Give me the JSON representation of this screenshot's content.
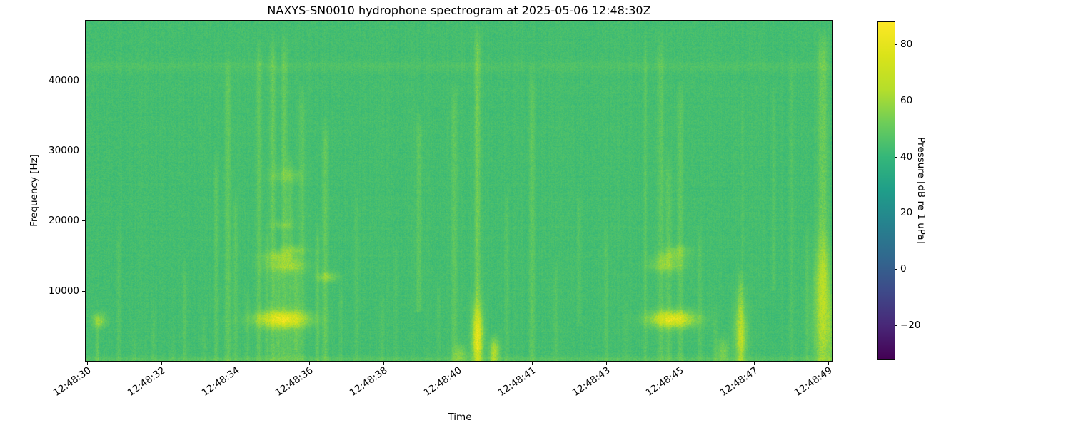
{
  "chart_data": {
    "type": "heatmap",
    "subtype": "spectrogram",
    "title": "NAXYS-SN0010 hydrophone spectrogram at 2025-05-06 12:48:30Z",
    "xlabel": "Time",
    "ylabel": "Frequency [Hz]",
    "x_ticks": [
      "12:48:30",
      "12:48:32",
      "12:48:34",
      "12:48:36",
      "12:48:38",
      "12:48:40",
      "12:48:41",
      "12:48:43",
      "12:48:45",
      "12:48:47",
      "12:48:49"
    ],
    "x_tick_interval_s": 1.9,
    "x_start_label": "12:48:30",
    "y_ticks": [
      {
        "label": "10000",
        "value": 10000
      },
      {
        "label": "20000",
        "value": 20000
      },
      {
        "label": "30000",
        "value": 30000
      },
      {
        "label": "40000",
        "value": 40000
      }
    ],
    "f_range_hz": [
      0,
      48500
    ],
    "t_range_s": [
      0,
      19.2
    ],
    "background_level_db": 43.5,
    "noise_db": 3.2,
    "colorbar": {
      "label": "Pressure [dB re 1 uPa]",
      "vmin": -32,
      "vmax": 88,
      "ticks": [
        {
          "label": "80",
          "value": 80
        },
        {
          "label": "60",
          "value": 60
        },
        {
          "label": "40",
          "value": 40
        },
        {
          "label": "20",
          "value": 20
        },
        {
          "label": "0",
          "value": 0
        },
        {
          "label": "−20",
          "value": -20
        }
      ],
      "colormap": "viridis",
      "stops": [
        "#440154",
        "#482878",
        "#3e4a89",
        "#31688e",
        "#26828e",
        "#1f9e89",
        "#35b779",
        "#6dcd59",
        "#b5de2b",
        "#dae319",
        "#fde725"
      ]
    },
    "horizontal_bands": [
      {
        "f_hz": 42000,
        "sigma_hz": 500,
        "amp_db": 2.5
      },
      {
        "f_hz": 250,
        "sigma_hz": 280,
        "amp_db": 4
      }
    ],
    "events": {
      "streaks_format": [
        "t_s_after_start",
        "f_lo_hz",
        "f_hi_hz",
        "amp_db",
        "width_px"
      ],
      "streaks": [
        [
          0.25,
          0,
          7000,
          6,
          2
        ],
        [
          0.8,
          0,
          20000,
          4,
          2
        ],
        [
          1.2,
          0,
          6000,
          3,
          2
        ],
        [
          1.7,
          0,
          9000,
          4,
          2
        ],
        [
          2.2,
          0,
          5000,
          3,
          2
        ],
        [
          2.5,
          0,
          15000,
          5,
          2
        ],
        [
          3.0,
          0,
          8000,
          3,
          2
        ],
        [
          3.3,
          0,
          30000,
          6,
          2
        ],
        [
          3.6,
          0,
          44000,
          7,
          3
        ],
        [
          3.8,
          0,
          25000,
          5,
          2
        ],
        [
          4.1,
          0,
          12000,
          4,
          2
        ],
        [
          4.4,
          0,
          46000,
          6,
          3
        ],
        [
          4.6,
          0,
          20000,
          5,
          2
        ],
        [
          4.75,
          0,
          47000,
          8,
          3
        ],
        [
          4.9,
          0,
          16000,
          7,
          3
        ],
        [
          5.05,
          0,
          47000,
          7,
          3
        ],
        [
          5.2,
          0,
          30000,
          6,
          3
        ],
        [
          5.35,
          0,
          16000,
          8,
          3
        ],
        [
          5.5,
          0,
          40000,
          6,
          3
        ],
        [
          5.9,
          0,
          20000,
          6,
          2
        ],
        [
          6.1,
          0,
          35000,
          7,
          3
        ],
        [
          6.5,
          0,
          12000,
          4,
          2
        ],
        [
          6.9,
          0,
          25000,
          4,
          2
        ],
        [
          7.55,
          0,
          10000,
          3,
          2
        ],
        [
          7.9,
          0,
          18000,
          3,
          2
        ],
        [
          8.5,
          7000,
          36000,
          6,
          3
        ],
        [
          9.0,
          0,
          12000,
          3,
          2
        ],
        [
          9.4,
          0,
          40000,
          6,
          3
        ],
        [
          10.0,
          0,
          48000,
          10,
          3
        ],
        [
          10.4,
          0,
          4000,
          10,
          3
        ],
        [
          10.75,
          0,
          25000,
          4,
          2
        ],
        [
          11.4,
          0,
          42000,
          6,
          3
        ],
        [
          12.0,
          0,
          15000,
          4,
          2
        ],
        [
          12.6,
          5000,
          25000,
          4,
          2
        ],
        [
          13.3,
          0,
          20000,
          4,
          2
        ],
        [
          13.8,
          0,
          10000,
          3,
          2
        ],
        [
          14.3,
          0,
          47000,
          5,
          2
        ],
        [
          14.7,
          0,
          47000,
          6,
          3
        ],
        [
          14.9,
          0,
          30000,
          6,
          3
        ],
        [
          15.2,
          0,
          40000,
          6,
          3
        ],
        [
          15.7,
          0,
          20000,
          5,
          2
        ],
        [
          16.1,
          0,
          8000,
          5,
          2
        ],
        [
          16.75,
          0,
          14000,
          11,
          3
        ],
        [
          16.8,
          14000,
          40000,
          3,
          2
        ],
        [
          17.6,
          10000,
          40000,
          4,
          2
        ],
        [
          18.05,
          0,
          45000,
          4,
          2
        ],
        [
          18.45,
          0,
          20000,
          4,
          2
        ],
        [
          18.85,
          0,
          47500,
          9,
          5
        ],
        [
          19.05,
          0,
          10000,
          7,
          3
        ]
      ],
      "blobs_format": [
        "t_s_after_start",
        "f_center_hz",
        "f_sigma_hz",
        "t_sigma_s",
        "amp_db"
      ],
      "blobs": [
        [
          0.3,
          5800,
          700,
          0.12,
          16
        ],
        [
          5.0,
          6000,
          800,
          0.45,
          34
        ],
        [
          5.1,
          13600,
          600,
          0.35,
          14
        ],
        [
          4.95,
          14900,
          500,
          0.3,
          12
        ],
        [
          5.25,
          15900,
          450,
          0.25,
          10
        ],
        [
          5.0,
          19500,
          400,
          0.2,
          7
        ],
        [
          5.1,
          26500,
          700,
          0.3,
          7
        ],
        [
          6.15,
          12000,
          500,
          0.18,
          12
        ],
        [
          9.55,
          1000,
          900,
          0.12,
          12
        ],
        [
          10.0,
          3500,
          3000,
          0.1,
          30
        ],
        [
          10.45,
          1500,
          1200,
          0.09,
          16
        ],
        [
          15.0,
          6000,
          800,
          0.4,
          34
        ],
        [
          14.85,
          13600,
          600,
          0.3,
          13
        ],
        [
          14.95,
          14900,
          500,
          0.28,
          11
        ],
        [
          15.15,
          15900,
          450,
          0.22,
          9
        ],
        [
          16.3,
          1500,
          1200,
          0.1,
          11
        ],
        [
          16.75,
          4000,
          3000,
          0.12,
          16
        ],
        [
          18.85,
          6000,
          5000,
          0.18,
          14
        ],
        [
          18.85,
          13000,
          3500,
          0.14,
          9
        ]
      ]
    }
  }
}
